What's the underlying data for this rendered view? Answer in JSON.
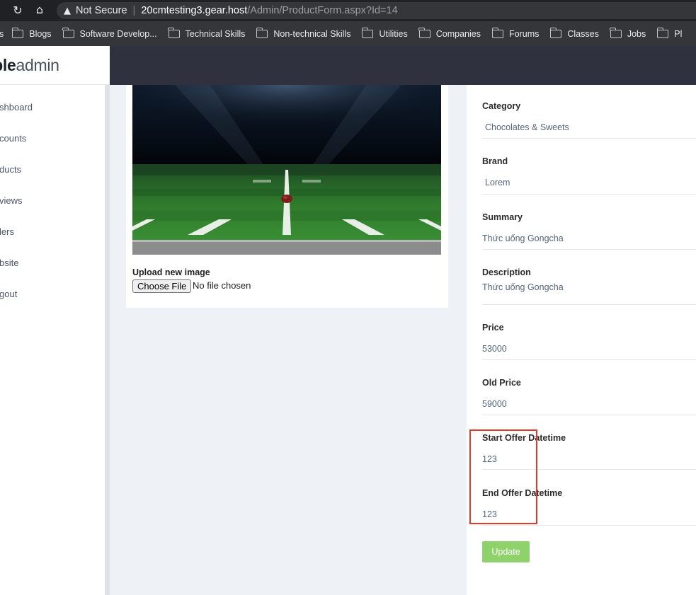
{
  "browser": {
    "url_warning": "Not Secure",
    "url_host": "20cmtesting3.gear.host",
    "url_path": "/Admin/ProductForm.aspx?Id=14",
    "bookmarks_partial": "s",
    "bookmarks": [
      "Blogs",
      "Software Develop...",
      "Technical Skills",
      "Non-technical Skills",
      "Utilities",
      "Companies",
      "Forums",
      "Classes",
      "Jobs",
      "Pl"
    ]
  },
  "app": {
    "logo_bold": "mple",
    "logo_light": "admin"
  },
  "sidebar": {
    "items": [
      "shboard",
      "counts",
      "ducts",
      "views",
      "lers",
      "bsite",
      "gout"
    ]
  },
  "image_panel": {
    "upload_label": "Upload new image",
    "choose_file_button": "Choose File",
    "no_file_text": "No file chosen"
  },
  "form": {
    "category": {
      "label": "Category",
      "value": "Chocolates & Sweets"
    },
    "brand": {
      "label": "Brand",
      "value": "Lorem"
    },
    "summary": {
      "label": "Summary",
      "value": "Thức uống Gongcha"
    },
    "description": {
      "label": "Description",
      "value": "Thức uống Gongcha"
    },
    "price": {
      "label": "Price",
      "value": "53000"
    },
    "old_price": {
      "label": "Old Price",
      "value": "59000"
    },
    "start_offer": {
      "label": "Start Offer Datetime",
      "value": "123"
    },
    "end_offer": {
      "label": "End Offer Datetime",
      "value": "123"
    },
    "update_button": "Update"
  },
  "colors": {
    "topbar": "#2f323e",
    "update_button": "#8fd16a",
    "highlight": "#e03c2c"
  }
}
